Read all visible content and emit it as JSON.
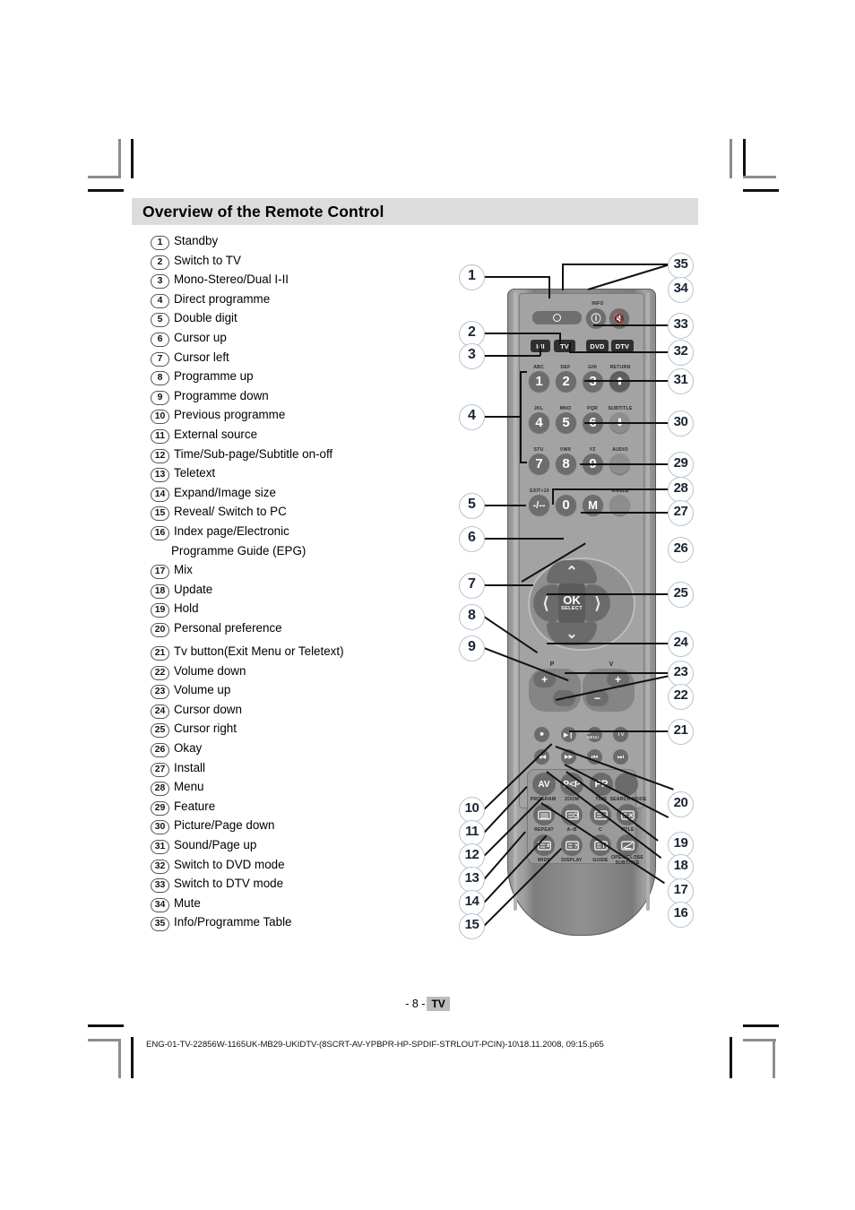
{
  "page": {
    "title": "Overview of the Remote Control",
    "page_number": "- 8 -",
    "page_badge": "TV",
    "file_code": "ENG-01-TV-22856W-1165UK-MB29-UKIDTV-(8SCRT-AV-YPBPR-HP-SPDIF-STRLOUT-PCIN)-10\\18.11.2008, 09:15.p65",
    "title_band_color": "#dcdcdc"
  },
  "legend": [
    {
      "num": "1",
      "label": "Standby"
    },
    {
      "num": "2",
      "label": "Switch to TV"
    },
    {
      "num": "3",
      "label": "Mono-Stereo/Dual I-II"
    },
    {
      "num": "4",
      "label": "Direct programme"
    },
    {
      "num": "5",
      "label": "Double digit"
    },
    {
      "num": "6",
      "label": "Cursor up"
    },
    {
      "num": "7",
      "label": "Cursor left"
    },
    {
      "num": "8",
      "label": "Programme up"
    },
    {
      "num": "9",
      "label": "Programme down"
    },
    {
      "num": "10",
      "label": "Previous programme"
    },
    {
      "num": "11",
      "label": "External source"
    },
    {
      "num": "12",
      "label": "Time/Sub-page/Subtitle on-off"
    },
    {
      "num": "13",
      "label": "Teletext"
    },
    {
      "num": "14",
      "label": "Expand/Image size"
    },
    {
      "num": "15",
      "label": "Reveal/ Switch to PC"
    },
    {
      "num": "16",
      "label": "Index page/Electronic"
    },
    {
      "num": "17",
      "label": "Mix"
    },
    {
      "num": "18",
      "label": "Update"
    },
    {
      "num": "19",
      "label": "Hold"
    },
    {
      "num": "20",
      "label": "Personal preference"
    },
    {
      "num": "21",
      "label": "Tv button(Exit Menu or Teletext)"
    },
    {
      "num": "22",
      "label": "Volume down"
    },
    {
      "num": "23",
      "label": "Volume up"
    },
    {
      "num": "24",
      "label": "Cursor down"
    },
    {
      "num": "25",
      "label": "Cursor right"
    },
    {
      "num": "26",
      "label": "Okay"
    },
    {
      "num": "27",
      "label": "Install"
    },
    {
      "num": "28",
      "label": "Menu"
    },
    {
      "num": "29",
      "label": "Feature"
    },
    {
      "num": "30",
      "label": "Picture/Page down"
    },
    {
      "num": "31",
      "label": "Sound/Page up"
    },
    {
      "num": "32",
      "label": "Switch to DVD mode"
    },
    {
      "num": "33",
      "label": "Switch to DTV mode"
    },
    {
      "num": "34",
      "label": "Mute"
    },
    {
      "num": "35",
      "label": "Info/Programme Table"
    }
  ],
  "legend_continuation": "Programme Guide (EPG)",
  "callouts_left": [
    "1",
    "2",
    "3",
    "4",
    "5",
    "6",
    "7",
    "8",
    "9",
    "10",
    "11",
    "12",
    "13",
    "14",
    "15"
  ],
  "callouts_right": [
    "35",
    "34",
    "33",
    "32",
    "31",
    "30",
    "29",
    "28",
    "27",
    "26",
    "25",
    "24",
    "23",
    "22",
    "21",
    "20",
    "19",
    "18",
    "17",
    "16"
  ],
  "remote": {
    "standby_label": "",
    "source_keys": [
      {
        "name": "mono-stereo",
        "label": "I-II"
      },
      {
        "name": "tv",
        "label": "TV"
      },
      {
        "name": "dvd",
        "label": "DVD"
      },
      {
        "name": "dtv",
        "label": "DTV"
      }
    ],
    "info_label": "INFO",
    "numpad": [
      {
        "digit": "1",
        "alpha": "ABC"
      },
      {
        "digit": "2",
        "alpha": "DEF"
      },
      {
        "digit": "3",
        "alpha": "GHI"
      },
      {
        "digit": "4",
        "alpha": "JKL"
      },
      {
        "digit": "5",
        "alpha": "MNO"
      },
      {
        "digit": "6",
        "alpha": "PQR"
      },
      {
        "digit": "7",
        "alpha": "STU"
      },
      {
        "digit": "8",
        "alpha": "VWX"
      },
      {
        "digit": "9",
        "alpha": "YZ"
      },
      {
        "digit": "0",
        "alpha": ""
      }
    ],
    "right_column": [
      {
        "name": "return",
        "label": "RETURN",
        "glyph": "⬆"
      },
      {
        "name": "subtitle",
        "label": "SUBTITLE",
        "glyph": "⬇"
      },
      {
        "name": "audio",
        "label": "AUDIO",
        "glyph": ""
      },
      {
        "name": "angle",
        "label": "ANGLE",
        "glyph": ""
      }
    ],
    "exit_label": "EXIT+10",
    "exit_glyph": "-/--",
    "menu_key": "M",
    "ok_label": "OK",
    "ok_sub": "SELECT",
    "rocker_p": "P",
    "rocker_v": "V",
    "plus": "+",
    "minus": "−",
    "transport_row1": [
      {
        "name": "stop",
        "glyph": "■"
      },
      {
        "name": "play-pause",
        "glyph": "▶❙"
      },
      {
        "name": "d-menu",
        "glyph": "D-MENU"
      },
      {
        "name": "tv-exit",
        "glyph": "TV"
      }
    ],
    "transport_row2": [
      {
        "name": "rewind",
        "glyph": "◀◀"
      },
      {
        "name": "fast-forward",
        "glyph": "▶▶"
      },
      {
        "name": "previous-track",
        "glyph": "⏮"
      },
      {
        "name": "next-track",
        "glyph": "⏭"
      }
    ],
    "teletext": [
      {
        "name": "av",
        "face": "AV",
        "label": "PROGRAM"
      },
      {
        "name": "p-less-p",
        "face": "P<P",
        "label": "ZOOM"
      },
      {
        "name": "pp",
        "face": "PP",
        "label": "TIME"
      },
      {
        "name": "search",
        "face": "",
        "label": "SEARCH MODE"
      },
      {
        "name": "teletext",
        "face": "",
        "label": "REPEAT"
      },
      {
        "name": "update",
        "face": "",
        "label": "A–B"
      },
      {
        "name": "mix",
        "face": "",
        "label": "C"
      },
      {
        "name": "cancel",
        "face": "",
        "label": "TITLE"
      },
      {
        "name": "expand",
        "face": "",
        "label": "WIDE"
      },
      {
        "name": "reveal",
        "face": "",
        "label": "DISPLAY"
      },
      {
        "name": "index",
        "face": "",
        "label": "GUIDE"
      },
      {
        "name": "hold",
        "face": "",
        "label": "OPEN/CLOSE SUBTITLE"
      }
    ]
  }
}
